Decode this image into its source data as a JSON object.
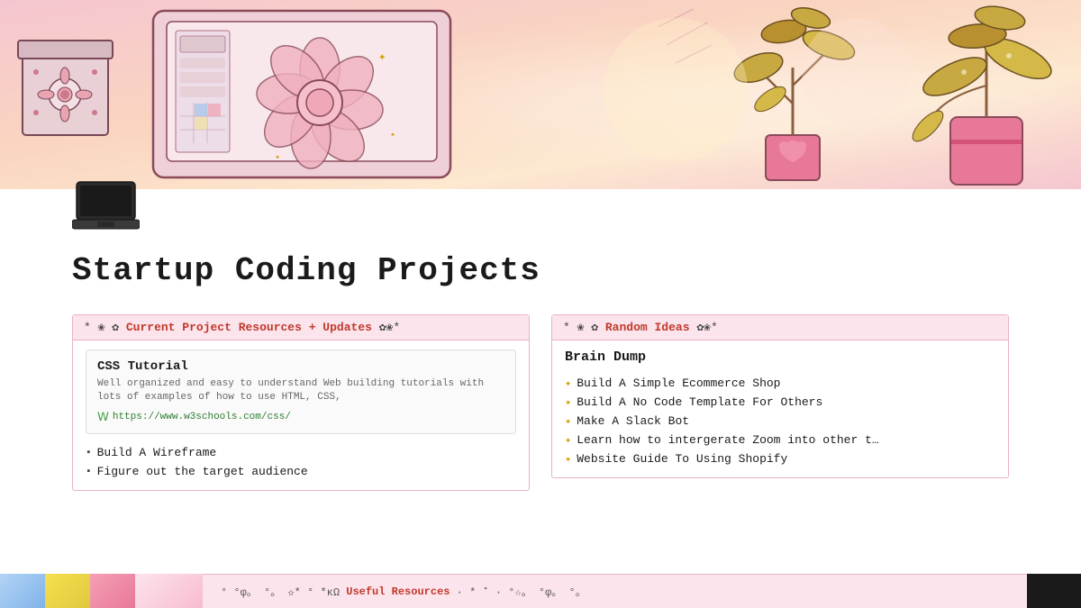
{
  "page": {
    "title": "Startup Coding Projects"
  },
  "hero": {
    "alt": "Cozy coding workspace illustration with laptop, flowers, and plants"
  },
  "left_section": {
    "header_deco_left": "* ❀ ✿",
    "header_label": "Current Project Resources + Updates",
    "header_deco_right": "✿❀*",
    "link_card": {
      "title": "CSS Tutorial",
      "description": "Well organized and easy to understand Web building tutorials with lots of examples of how to use HTML, CSS,",
      "url": "https://www.w3schools.com/css/"
    },
    "bullet_items": [
      "Build A Wireframe",
      "Figure out the target audience"
    ]
  },
  "right_section": {
    "header_deco_left": "* ❀ ✿",
    "header_label": "Random Ideas",
    "header_deco_right": "✿❀*",
    "subtitle": "Brain Dump",
    "idea_items": [
      "Build A Simple Ecommerce Shop",
      "Build A No Code Template For Others",
      "Make A Slack Bot",
      "Learn how to intergerate Zoom into other t…",
      "Website Guide To Using Shopify"
    ]
  },
  "bottom_bar": {
    "deco_left": "° °φ。 °。 ✫* ° *κΩ",
    "label": "Useful Resources",
    "deco_right": "· * ˚ · °☆。 °φ。 °。",
    "dark_block": true
  },
  "icons": {
    "laptop": "💻",
    "sparkle": "✦",
    "link_icon": "W"
  }
}
